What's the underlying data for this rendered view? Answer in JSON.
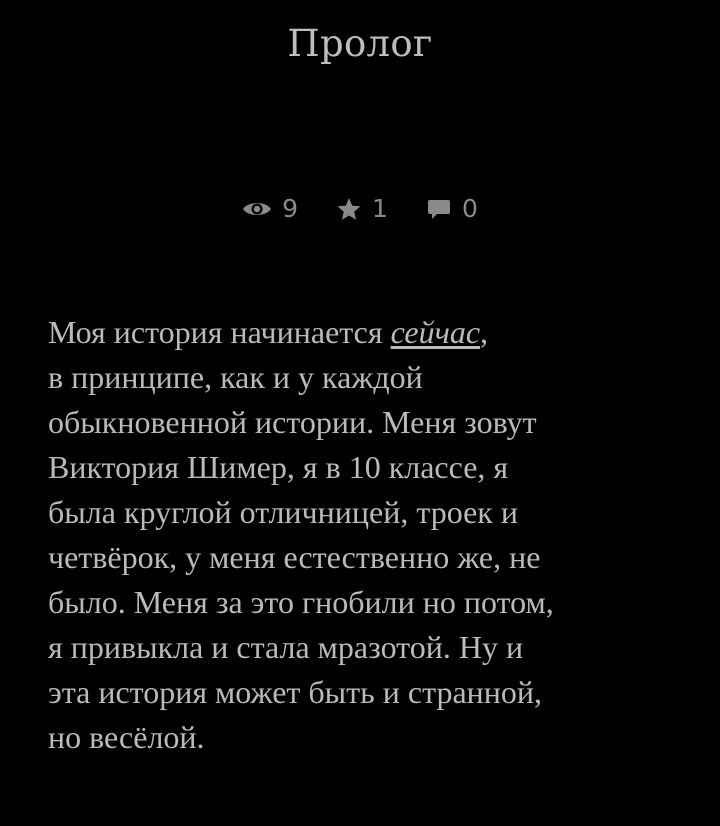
{
  "chapter": {
    "title": "Пролог"
  },
  "stats": {
    "views": "9",
    "stars": "1",
    "comments": "0"
  },
  "story": {
    "line1_before": "Моя история начинается ",
    "line1_link": "сейчас",
    "line1_after": ",",
    "line2": "в принципе, как и у каждой",
    "line3": "обыкновенной истории. Меня зовут",
    "line4": "Виктория Шимер, я в 10 классе, я",
    "line5": "была круглой отличницей, троек и",
    "line6": "четвёрок, у меня естественно же, не",
    "line7": "было. Меня за это гнобили но потом,",
    "line8": "я привыкла и стала мразотой. Ну и",
    "line9": "эта история может быть и странной,",
    "line10": "но весёлой."
  },
  "colors": {
    "background": "#000000",
    "text": "#bababa",
    "meta": "#8a8a8a"
  },
  "icons": {
    "views": "eye-icon",
    "stars": "star-icon",
    "comments": "comment-icon"
  }
}
